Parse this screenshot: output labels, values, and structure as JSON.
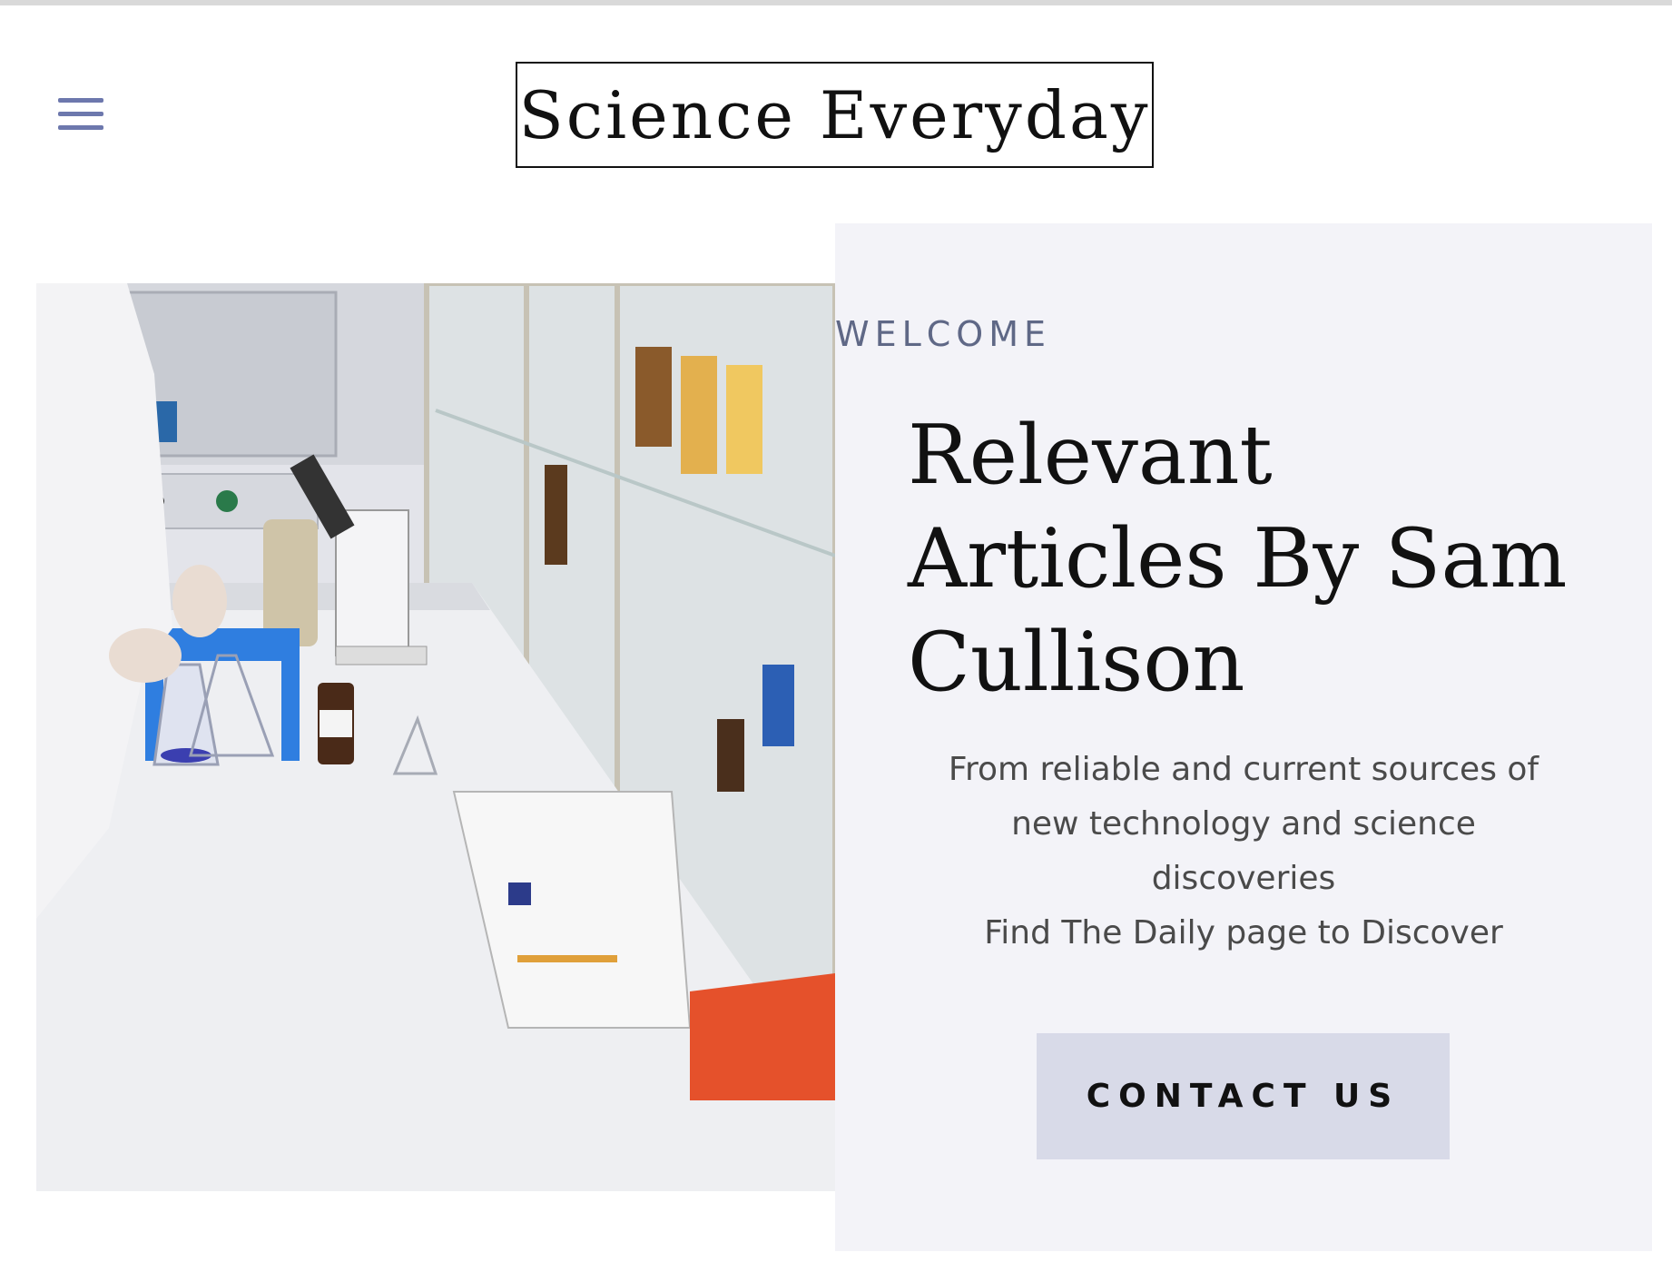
{
  "header": {
    "menu_icon": "hamburger-menu-icon",
    "site_title": "Science Everyday"
  },
  "hero": {
    "image_subject": "laboratory bench with microscope, glassware and blue test tube rack",
    "eyebrow": "WELCOME",
    "headline": "Relevant Articles By Sam Cullison",
    "description_lines": [
      "From reliable and current sources of new technology and science discoveries",
      "Find The Daily page to Discover"
    ],
    "cta_label": "CONTACT US"
  },
  "colors": {
    "accent": "#6d78ad",
    "panel_bg": "#f3f3f8",
    "button_bg": "#d8dae8",
    "text_dark": "#111111"
  }
}
